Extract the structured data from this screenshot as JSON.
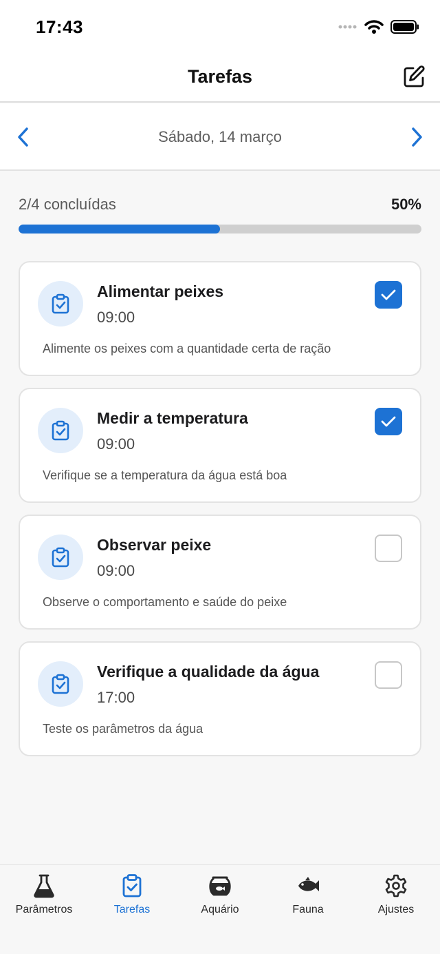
{
  "status_bar": {
    "time": "17:43"
  },
  "header": {
    "title": "Tarefas",
    "edit_icon": "edit-icon"
  },
  "date_nav": {
    "date": "Sábado, 14 março",
    "prev_icon": "chevron-left-icon",
    "next_icon": "chevron-right-icon"
  },
  "progress": {
    "label": "2/4 concluídas",
    "percent_text": "50%",
    "fraction": 0.5
  },
  "tasks": [
    {
      "title": "Alimentar peixes",
      "time": "09:00",
      "description": "Alimente os peixes com a quantidade certa de ração",
      "completed": true
    },
    {
      "title": "Medir a temperatura",
      "time": "09:00",
      "description": "Verifique se a temperatura da água está boa",
      "completed": true
    },
    {
      "title": "Observar peixe",
      "time": "09:00",
      "description": "Observe o comportamento e saúde do peixe",
      "completed": false
    },
    {
      "title": "Verifique a qualidade da água",
      "time": "17:00",
      "description": "Teste os parâmetros da água",
      "completed": false
    }
  ],
  "tab_bar": {
    "items": [
      {
        "label": "Parâmetros",
        "icon": "flask-icon",
        "active": false
      },
      {
        "label": "Tarefas",
        "icon": "clipboard-check-icon",
        "active": true
      },
      {
        "label": "Aquário",
        "icon": "fishbowl-icon",
        "active": false
      },
      {
        "label": "Fauna",
        "icon": "fish-icon",
        "active": false
      },
      {
        "label": "Ajustes",
        "icon": "gear-icon",
        "active": false
      }
    ]
  },
  "colors": {
    "accent": "#1d72d4",
    "icon_bg": "#e3eefb",
    "track": "#cfcfcf"
  }
}
